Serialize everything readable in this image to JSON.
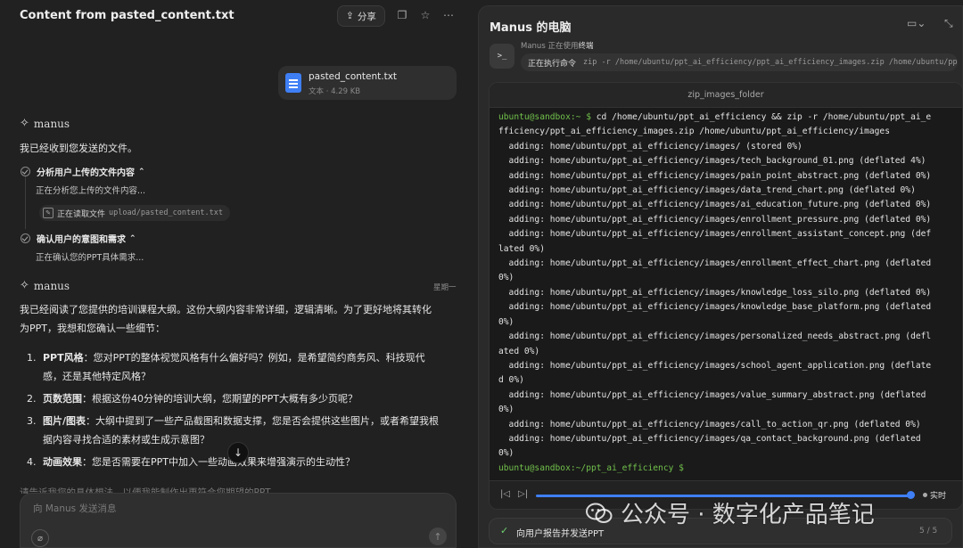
{
  "left": {
    "title": "Content from pasted_content.txt",
    "share_label": "分享",
    "file": {
      "name": "pasted_content.txt",
      "meta": "文本 · 4.29 KB"
    },
    "brand": "manus",
    "msg1": "我已经收到您发送的文件。",
    "steps": [
      {
        "title": "分析用户上传的文件内容",
        "sub": "正在分析您上传的文件内容...",
        "tool_action": "正在读取文件",
        "tool_path": "upload/pasted_content.txt"
      },
      {
        "title": "确认用户的意图和需求",
        "sub": "正在确认您的PPT具体需求..."
      }
    ],
    "time_label": "星期一",
    "msg2_line1": "我已经阅读了您提供的培训课程大纲。这份大纲内容非常详细，逻辑清晰。为了更好地将其转化",
    "msg2_line2": "为PPT，我想和您确认一些细节：",
    "questions": [
      {
        "num": "1.",
        "bold": "PPT风格",
        "text_line1": "：您对PPT的整体视觉风格有什么偏好吗？例如，是希望简约商务风、科技现代",
        "text_line2": "感，还是其他特定风格？"
      },
      {
        "num": "2.",
        "bold": "页数范围",
        "text_line1": "：根据这份40分钟的培训大纲，您期望的PPT大概有多少页呢？",
        "text_line2": ""
      },
      {
        "num": "3.",
        "bold": "图片/图表",
        "text_line1": "：大纲中提到了一些产品截图和数据支撑，您是否会提供这些图片，或者希望我根",
        "text_line2": "据内容寻找合适的素材或生成示意图？"
      },
      {
        "num": "4.",
        "bold": "动画效果",
        "text_line1": "：您是否需要在PPT中加入一些动画效果来增强演示的生动性？",
        "text_line2": ""
      }
    ],
    "trailing": "请告诉我您的具体想法，以便我能制作出更符合您期望的PPT。",
    "input_placeholder": "向 Manus 发送消息"
  },
  "right": {
    "title": "Manus 的电脑",
    "using_prefix": "Manus 正在使用",
    "using_tool": "终端",
    "cmd_label": "正在执行命令",
    "cmd_text": "zip -r /home/ubuntu/ppt_ai_efficiency/ppt_ai_efficiency_images.zip /home/ubuntu/ppt_ai_efficiency/images",
    "terminal_title": "zip_images_folder",
    "prompt1": "ubuntu@sandbox:~ $",
    "cmd_line1": " cd /home/ubuntu/ppt_ai_efficiency && zip -r /home/ubuntu/ppt_ai_e",
    "cmd_line2": "fficiency/ppt_ai_efficiency_images.zip /home/ubuntu/ppt_ai_efficiency/images",
    "output": [
      "  adding: home/ubuntu/ppt_ai_efficiency/images/ (stored 0%)",
      "  adding: home/ubuntu/ppt_ai_efficiency/images/tech_background_01.png (deflated 4%)",
      "  adding: home/ubuntu/ppt_ai_efficiency/images/pain_point_abstract.png (deflated 0%)",
      "  adding: home/ubuntu/ppt_ai_efficiency/images/data_trend_chart.png (deflated 0%)",
      "  adding: home/ubuntu/ppt_ai_efficiency/images/ai_education_future.png (deflated 0%)",
      "  adding: home/ubuntu/ppt_ai_efficiency/images/enrollment_pressure.png (deflated 0%)",
      "  adding: home/ubuntu/ppt_ai_efficiency/images/enrollment_assistant_concept.png (def",
      "lated 0%)",
      "  adding: home/ubuntu/ppt_ai_efficiency/images/enrollment_effect_chart.png (deflated",
      "0%)",
      "  adding: home/ubuntu/ppt_ai_efficiency/images/knowledge_loss_silo.png (deflated 0%)",
      "  adding: home/ubuntu/ppt_ai_efficiency/images/knowledge_base_platform.png (deflated",
      "0%)",
      "  adding: home/ubuntu/ppt_ai_efficiency/images/personalized_needs_abstract.png (defl",
      "ated 0%)",
      "  adding: home/ubuntu/ppt_ai_efficiency/images/school_agent_application.png (deflate",
      "d 0%)",
      "  adding: home/ubuntu/ppt_ai_efficiency/images/value_summary_abstract.png (deflated",
      "0%)",
      "  adding: home/ubuntu/ppt_ai_efficiency/images/call_to_action_qr.png (deflated 0%)",
      "  adding: home/ubuntu/ppt_ai_efficiency/images/qa_contact_background.png (deflated",
      "0%)"
    ],
    "prompt2": "ubuntu@sandbox:~/ppt_ai_efficiency $",
    "live_label": "实时",
    "task_label": "向用户报告并发送PPT",
    "task_count": "5 / 5"
  },
  "watermark": "公众号 · 数字化产品笔记",
  "colors": {
    "accent": "#3f7ff5",
    "prompt": "#71c14b",
    "bg": "#212121"
  }
}
